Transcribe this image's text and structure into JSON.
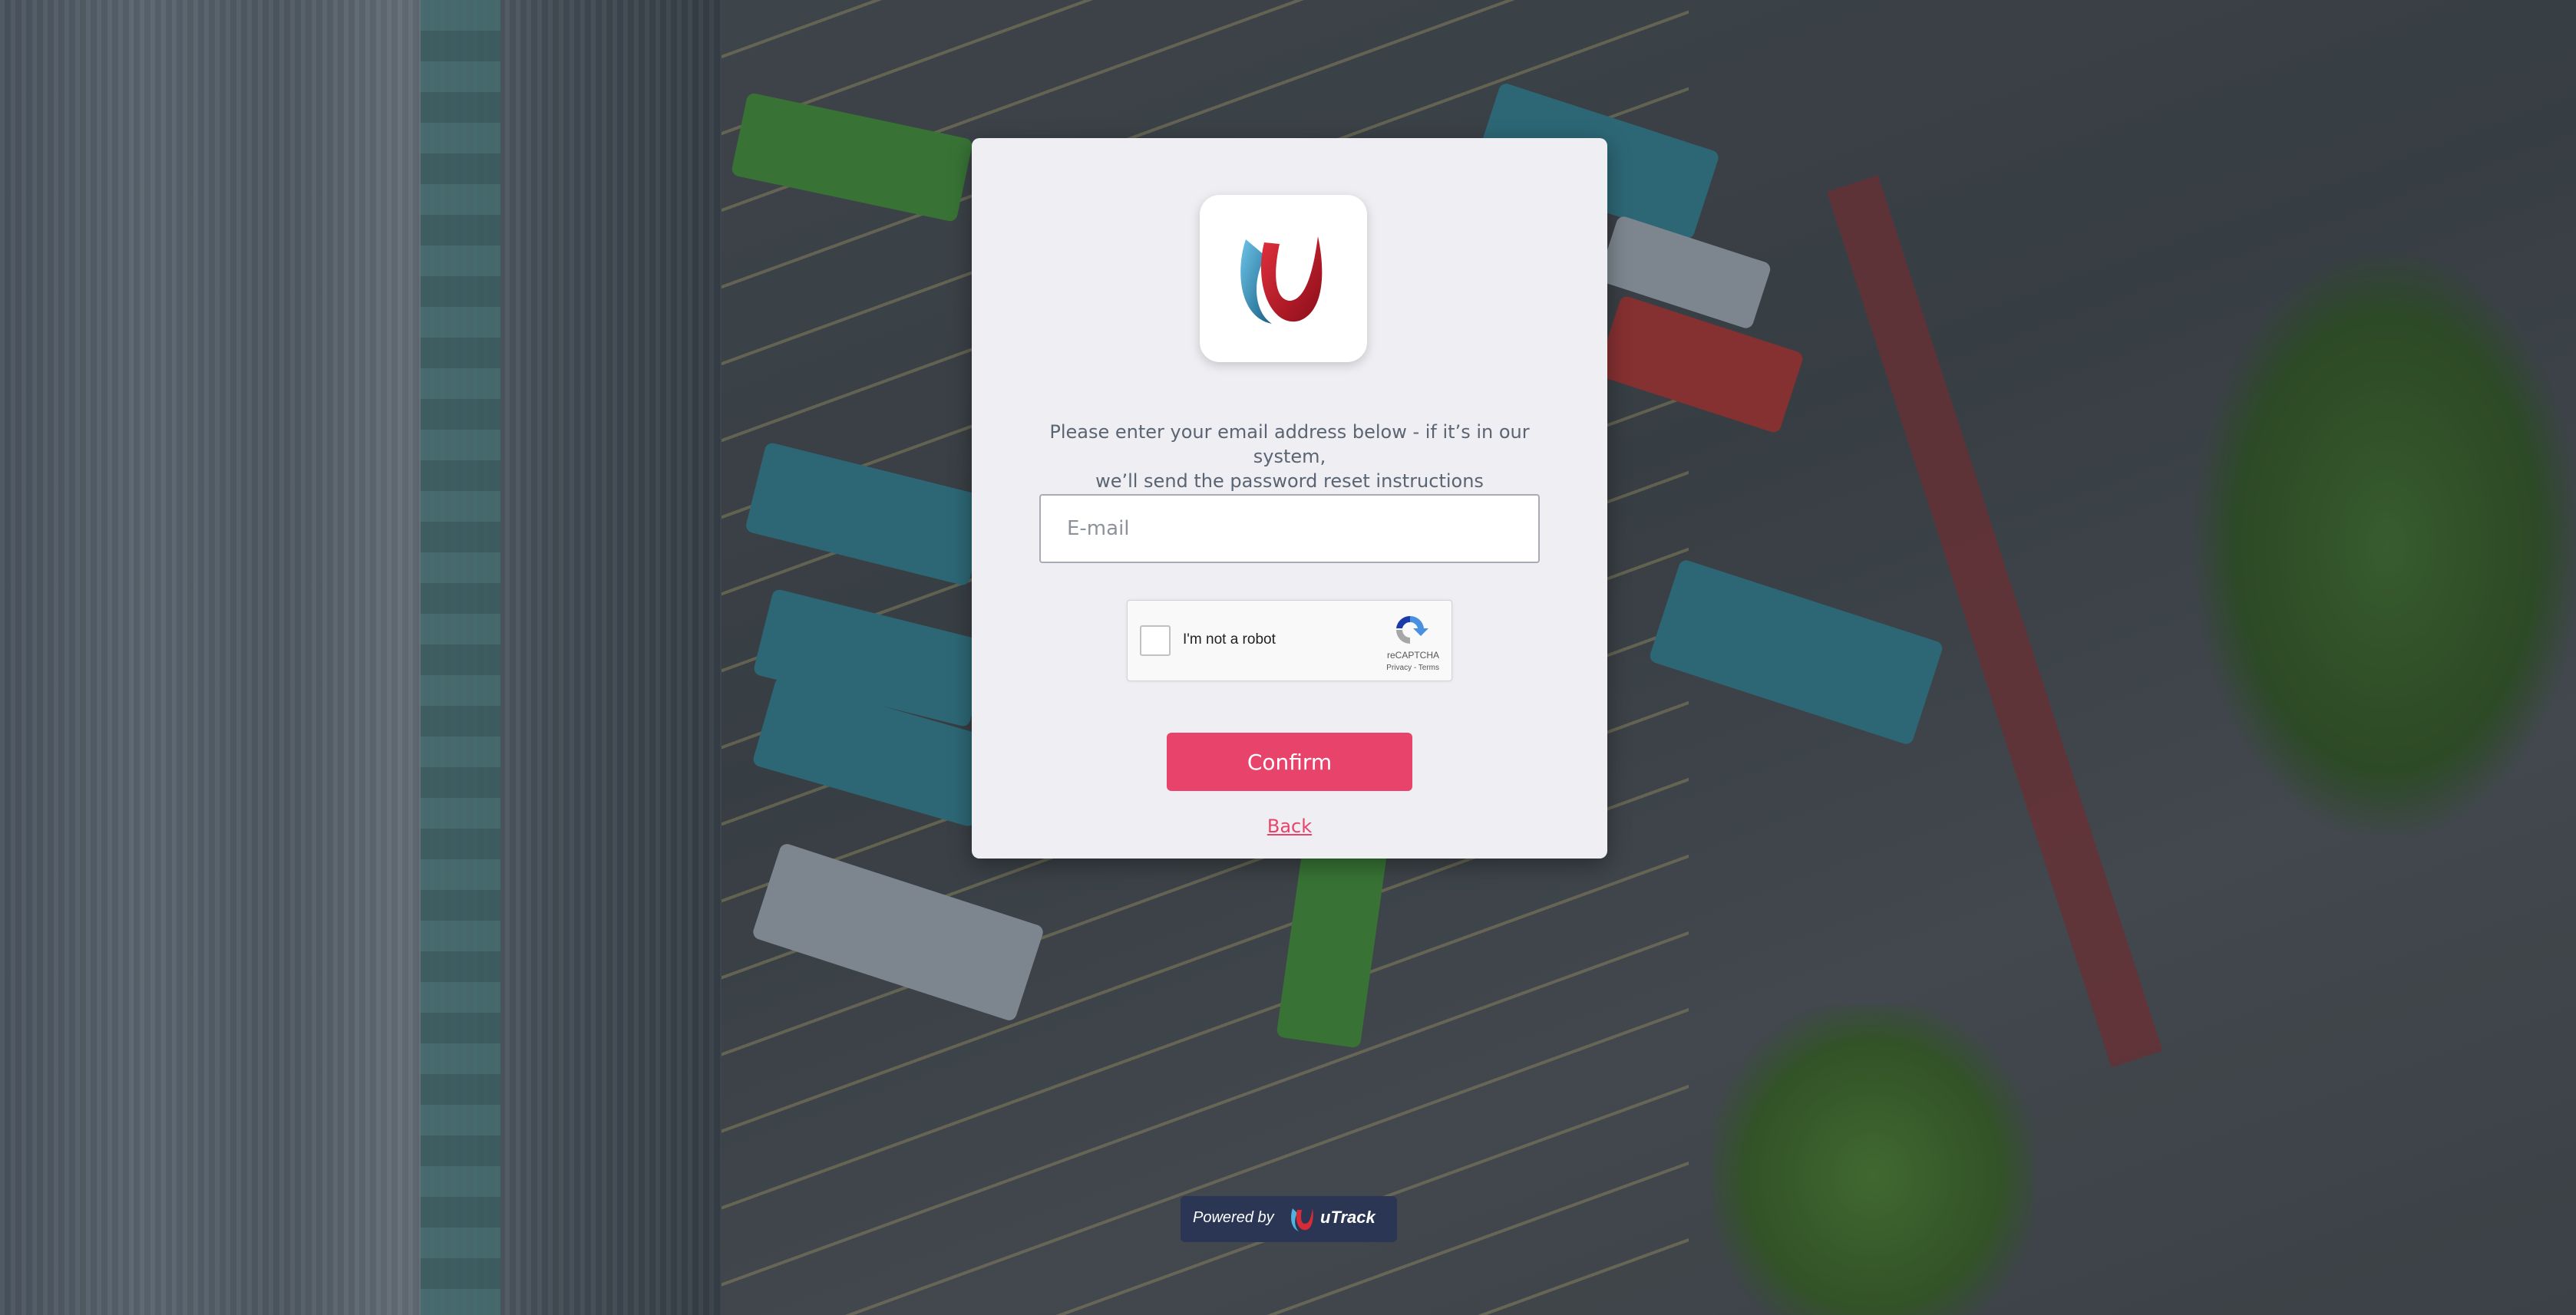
{
  "form": {
    "instructions_line1": "Please enter your email address below - if it’s in our system,",
    "instructions_line2": "we’ll send the password reset instructions",
    "email_placeholder": "E-mail",
    "email_value": "",
    "captcha_label": "I'm not a robot",
    "captcha_brand": "reCAPTCHA",
    "captcha_links": "Privacy - Terms",
    "confirm_label": "Confirm",
    "back_label": "Back"
  },
  "footer": {
    "powered_by": "Powered by",
    "brand": "uTrack"
  },
  "colors": {
    "accent": "#e8436b",
    "card_background": "#efeff3",
    "badge_background": "#2a3654"
  },
  "icons": {
    "logo": "utrack-logo-icon",
    "recaptcha": "recaptcha-icon"
  }
}
